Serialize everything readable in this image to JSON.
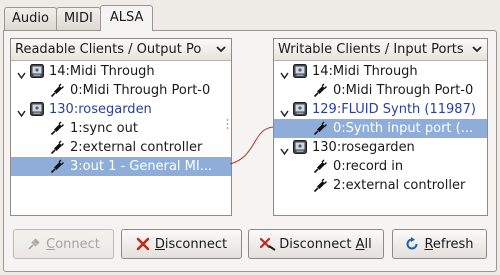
{
  "tabs": [
    {
      "label": "Audio"
    },
    {
      "label": "MIDI"
    },
    {
      "label": "ALSA",
      "active": true
    }
  ],
  "readable": {
    "header": "Readable Clients / Output Po",
    "rows": [
      {
        "kind": "client",
        "label": "14:Midi Through",
        "expanded": true
      },
      {
        "kind": "port",
        "label": "0:Midi Through Port-0"
      },
      {
        "kind": "client",
        "label": "130:rosegarden",
        "expanded": true,
        "highlight": true
      },
      {
        "kind": "port",
        "label": "1:sync out"
      },
      {
        "kind": "port",
        "label": "2:external controller"
      },
      {
        "kind": "port",
        "label": "3:out 1 - General MI...",
        "selected": true
      }
    ]
  },
  "writable": {
    "header": "Writable Clients / Input Ports",
    "rows": [
      {
        "kind": "client",
        "label": "14:Midi Through",
        "expanded": true
      },
      {
        "kind": "port",
        "label": "0:Midi Through Port-0"
      },
      {
        "kind": "client",
        "label": "129:FLUID Synth (11987)",
        "expanded": true,
        "highlight": true
      },
      {
        "kind": "port",
        "label": "0:Synth input port (...",
        "selected": true
      },
      {
        "kind": "client",
        "label": "130:rosegarden",
        "expanded": true
      },
      {
        "kind": "port",
        "label": "0:record in"
      },
      {
        "kind": "port",
        "label": "2:external controller"
      }
    ]
  },
  "buttons": {
    "connect": {
      "label": "Connect",
      "mnemonic": "C",
      "enabled": false
    },
    "disconnect": {
      "label": "Disconnect",
      "mnemonic": "D",
      "enabled": true
    },
    "disconnect_all": {
      "label": "Disconnect All",
      "mnemonic": "A",
      "enabled": true
    },
    "refresh": {
      "label": "Refresh",
      "mnemonic": "R",
      "enabled": true
    }
  },
  "colors": {
    "selection": "#8eaed9",
    "client_highlight": "#2a3fa0",
    "connection_line": "#b2352f",
    "disconnect_x": "#c0281f",
    "refresh_icon": "#1f5fb3"
  }
}
